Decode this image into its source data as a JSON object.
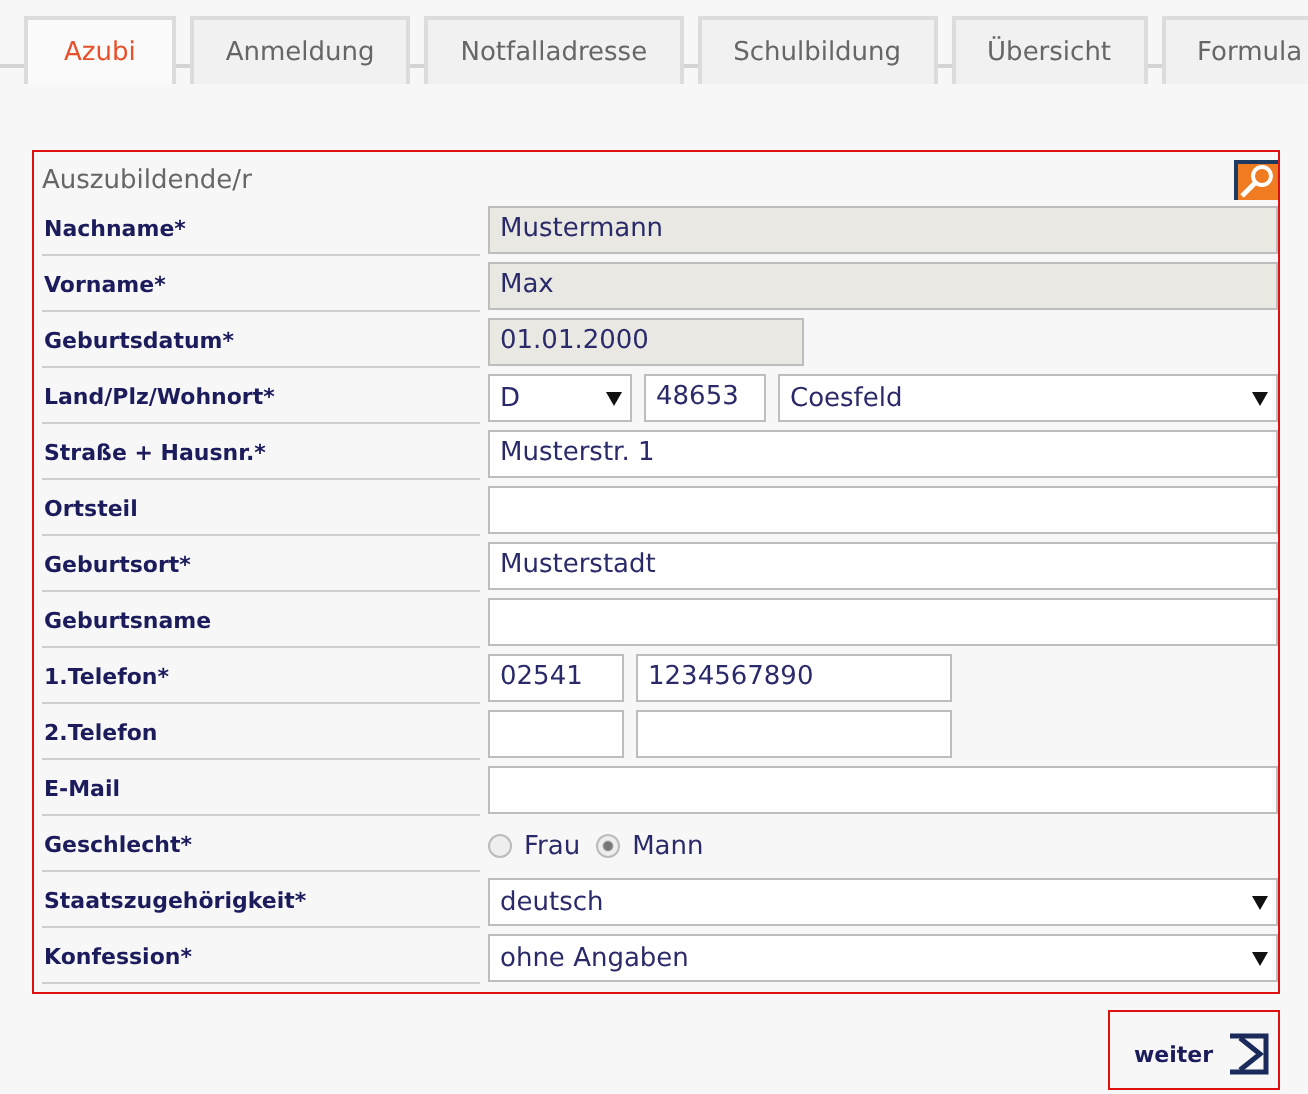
{
  "tabs": [
    {
      "label": "Azubi",
      "selected": true
    },
    {
      "label": "Anmeldung",
      "selected": false
    },
    {
      "label": "Notfalladresse",
      "selected": false
    },
    {
      "label": "Schulbildung",
      "selected": false
    },
    {
      "label": "Übersicht",
      "selected": false
    },
    {
      "label": "Formula",
      "selected": false
    }
  ],
  "section": {
    "title": "Auszubildende/r"
  },
  "rows": [
    {
      "label": "Nachname*",
      "fields": [
        {
          "kind": "input",
          "value": "Mustermann",
          "readonly": true
        }
      ]
    },
    {
      "label": "Vorname*",
      "fields": [
        {
          "kind": "input",
          "value": "Max",
          "readonly": true
        }
      ]
    },
    {
      "label": "Geburtsdatum*",
      "fields": [
        {
          "kind": "date",
          "value": "01.01.2000",
          "readonly": true
        }
      ]
    },
    {
      "label": "Land/Plz/Wohnort*",
      "fields": [
        {
          "kind": "select",
          "value": "D"
        },
        {
          "kind": "input",
          "value": "48653",
          "readonly": false
        },
        {
          "kind": "select",
          "value": "Coesfeld"
        }
      ]
    },
    {
      "label": "Straße + Hausnr.*",
      "fields": [
        {
          "kind": "input",
          "value": "Musterstr. 1",
          "readonly": false
        }
      ]
    },
    {
      "label": "Ortsteil",
      "fields": [
        {
          "kind": "input",
          "readonly": false
        }
      ]
    },
    {
      "label": "Geburtsort*",
      "fields": [
        {
          "kind": "input",
          "value": "Musterstadt",
          "readonly": false
        }
      ]
    },
    {
      "label": "Geburtsname",
      "fields": [
        {
          "kind": "input",
          "readonly": false
        }
      ]
    },
    {
      "label": "1.Telefon*",
      "fields": [
        {
          "kind": "input",
          "value": "02541",
          "readonly": false
        },
        {
          "kind": "input",
          "value": "1234567890",
          "readonly": false
        }
      ]
    },
    {
      "label": "2.Telefon",
      "fields": [
        {
          "kind": "input",
          "readonly": false
        },
        {
          "kind": "input",
          "readonly": false
        }
      ]
    },
    {
      "label": "E-Mail",
      "fields": [
        {
          "kind": "input",
          "readonly": false
        }
      ]
    },
    {
      "label": "Geschlecht*",
      "fields": [
        {
          "kind": "radio",
          "options": [
            {
              "label": "Frau",
              "selected": false
            },
            {
              "label": "Mann",
              "selected": true
            }
          ]
        }
      ]
    },
    {
      "label": "Staatszugehörigkeit*",
      "fields": [
        {
          "kind": "select",
          "value": "deutsch"
        }
      ]
    },
    {
      "label": "Konfession*",
      "fields": [
        {
          "kind": "select",
          "value": "ohne Angaben"
        }
      ]
    }
  ],
  "next_button": {
    "label": "weiter"
  }
}
